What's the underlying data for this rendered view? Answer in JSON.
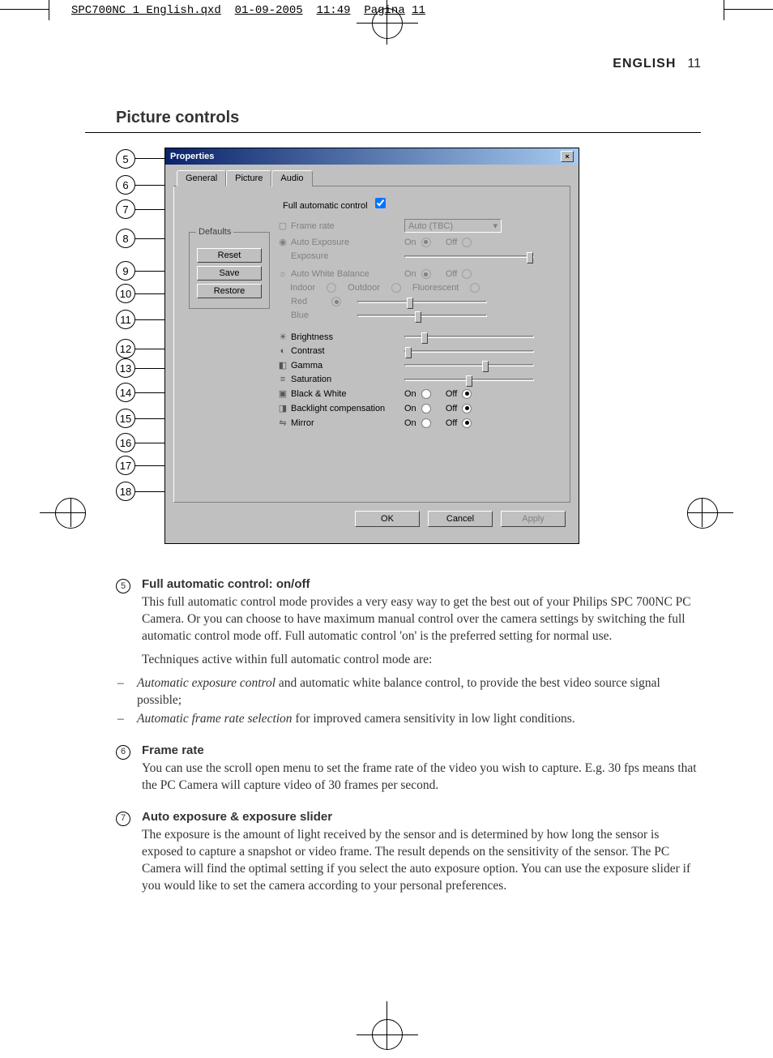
{
  "print_header": {
    "file": "SPC700NC_1_English.qxd",
    "date": "01-09-2005",
    "time": "11:49",
    "page_word": "Pagina",
    "page_num": "11"
  },
  "header": {
    "lang": "ENGLISH",
    "page": "11"
  },
  "section_title": "Picture controls",
  "callouts": [
    "5",
    "6",
    "7",
    "8",
    "9",
    "10",
    "11",
    "12",
    "13",
    "14",
    "15",
    "16",
    "17",
    "18"
  ],
  "dialog": {
    "title": "Properties",
    "close": "×",
    "tabs": [
      "General",
      "Picture",
      "Audio"
    ],
    "full_auto_label": "Full automatic control",
    "defaults": {
      "legend": "Defaults",
      "reset": "Reset",
      "save": "Save",
      "restore": "Restore"
    },
    "frame_rate": {
      "label": "Frame rate",
      "value": "Auto (TBC)"
    },
    "auto_exposure": {
      "label": "Auto Exposure",
      "on": "On",
      "off": "Off"
    },
    "exposure": {
      "label": "Exposure"
    },
    "awb": {
      "label": "Auto White Balance",
      "on": "On",
      "off": "Off"
    },
    "wb_modes": {
      "indoor": "Indoor",
      "outdoor": "Outdoor",
      "fluorescent": "Fluorescent"
    },
    "rb": {
      "red": "Red",
      "blue": "Blue"
    },
    "brightness": "Brightness",
    "contrast": "Contrast",
    "gamma": "Gamma",
    "saturation": "Saturation",
    "bw": {
      "label": "Black & White",
      "on": "On",
      "off": "Off"
    },
    "backlight": {
      "label": "Backlight compensation",
      "on": "On",
      "off": "Off"
    },
    "mirror": {
      "label": "Mirror",
      "on": "On",
      "off": "Off"
    },
    "ok": "OK",
    "cancel": "Cancel",
    "apply": "Apply"
  },
  "text": {
    "e5": {
      "title": "Full automatic control: on/off",
      "p1": "This full automatic control mode provides a very easy way to get the best out of your Philips SPC 700NC PC Camera. Or you can choose to have maximum manual control over the camera settings by switching the full automatic control mode off. Full automatic control 'on' is the preferred setting for normal use.",
      "p2": "Techniques active within full automatic control mode are:",
      "li1a": "Automatic exposure control",
      "li1b": " and automatic white balance control, to provide the best video source signal possible;",
      "li2a": "Automatic frame rate selection",
      "li2b": " for improved camera sensitivity in low light conditions."
    },
    "e6": {
      "title": "Frame rate",
      "p1": "You can use the scroll open menu to set the frame rate of the video you wish to capture. E.g. 30 fps means that the PC Camera will capture video of 30 frames per second."
    },
    "e7": {
      "title": "Auto exposure & exposure slider",
      "p1": "The exposure is the amount of light received by the sensor and is determined by how long the sensor is exposed to capture a snapshot or video frame. The result depends on the sensitivity of the sensor. The PC Camera will find the optimal setting if you select the auto exposure option. You can use the exposure slider if you would like to set the camera according to your personal preferences."
    }
  }
}
